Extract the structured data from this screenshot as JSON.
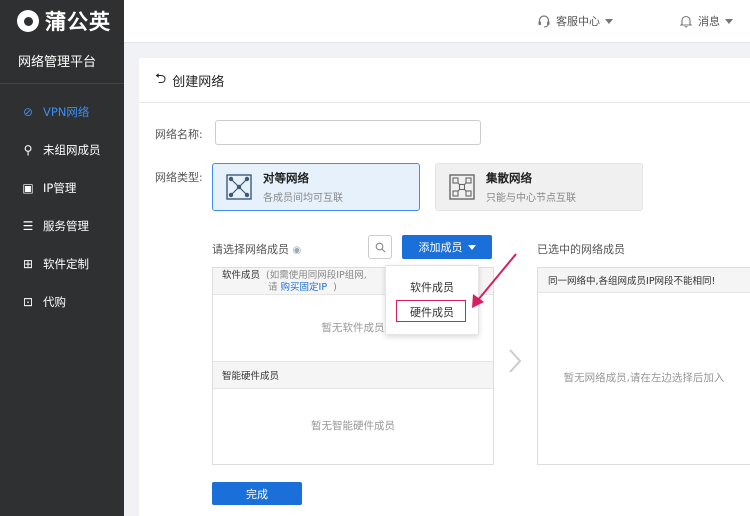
{
  "brand": {
    "logo_text": "蒲公英",
    "platform": "网络管理平台"
  },
  "sidebar": {
    "items": [
      {
        "label": "VPN网络",
        "icon": "vpn-icon",
        "glyph": "⊘",
        "active": true
      },
      {
        "label": "未组网成员",
        "icon": "user-icon",
        "glyph": "⚲",
        "active": false
      },
      {
        "label": "IP管理",
        "icon": "ip-icon",
        "glyph": "▣",
        "active": false
      },
      {
        "label": "服务管理",
        "icon": "service-icon",
        "glyph": "☰",
        "active": false
      },
      {
        "label": "软件定制",
        "icon": "grid-icon",
        "glyph": "⊞",
        "active": false
      },
      {
        "label": "代购",
        "icon": "bag-icon",
        "glyph": "⊡",
        "active": false
      }
    ]
  },
  "header": {
    "support": "客服中心",
    "messages": "消息"
  },
  "page": {
    "title": "创建网络"
  },
  "form": {
    "name_label": "网络名称:",
    "name_value": "",
    "type_label": "网络类型:",
    "types": [
      {
        "title": "对等网络",
        "desc": "各成员间均可互联",
        "selected": true
      },
      {
        "title": "集散网络",
        "desc": "只能与中心节点互联",
        "selected": false
      }
    ]
  },
  "members": {
    "select_label": "请选择网络成员",
    "add_button": "添加成员",
    "dropdown": [
      "软件成员",
      "硬件成员"
    ],
    "software_head": "软件成员",
    "software_note_1": "(如需使用同网段IP组网,",
    "software_note_2": "请",
    "software_note_link": "购买固定IP",
    "software_note_3": ")",
    "software_empty": "暂无软件成员",
    "hardware_head": "智能硬件成员",
    "hardware_empty": "暂无智能硬件成员",
    "selected_label": "已选中的网络成员",
    "selected_note": "同一网络中,各组网成员IP网段不能相同!",
    "selected_empty": "暂无网络成员,请在左边选择后加入"
  },
  "actions": {
    "done": "完成"
  },
  "colors": {
    "accent": "#1a6fd8",
    "sidebar": "#2f3031",
    "annotation": "#d81e63"
  }
}
